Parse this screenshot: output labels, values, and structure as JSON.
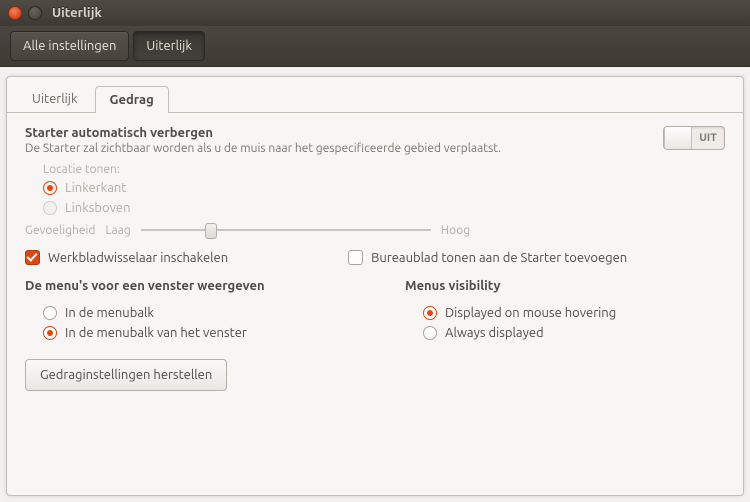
{
  "window": {
    "title": "Uiterlijk"
  },
  "breadcrumb": {
    "all_settings": "Alle instellingen",
    "current": "Uiterlijk"
  },
  "tabs": {
    "look": "Uiterlijk",
    "behavior": "Gedrag"
  },
  "autohide": {
    "title": "Starter automatisch verbergen",
    "subtitle": "De Starter zal zichtbaar worden als u de muis naar het gespecificeerde gebied verplaatst.",
    "toggle_off_label": "UIT",
    "enabled": false
  },
  "reveal_location": {
    "group_label": "Locatie tonen:",
    "left_side": "Linkerkant",
    "top_left": "Linksboven"
  },
  "sensitivity": {
    "label": "Gevoeligheid",
    "low": "Laag",
    "high": "Hoog"
  },
  "workspace_switcher": {
    "label": "Werkbladwisselaar inschakelen",
    "checked": true
  },
  "show_desktop": {
    "label": "Bureaublad tonen aan de Starter toevoegen",
    "checked": false
  },
  "menus_location": {
    "title": "De menu's voor een venster weergeven",
    "menubar": "In de menubalk",
    "titlebar": "In de menubalk van het venster"
  },
  "menus_visibility": {
    "title": "Menus visibility",
    "hover": "Displayed on mouse hovering",
    "always": "Always displayed"
  },
  "restore_button": "Gedraginstellingen herstellen"
}
